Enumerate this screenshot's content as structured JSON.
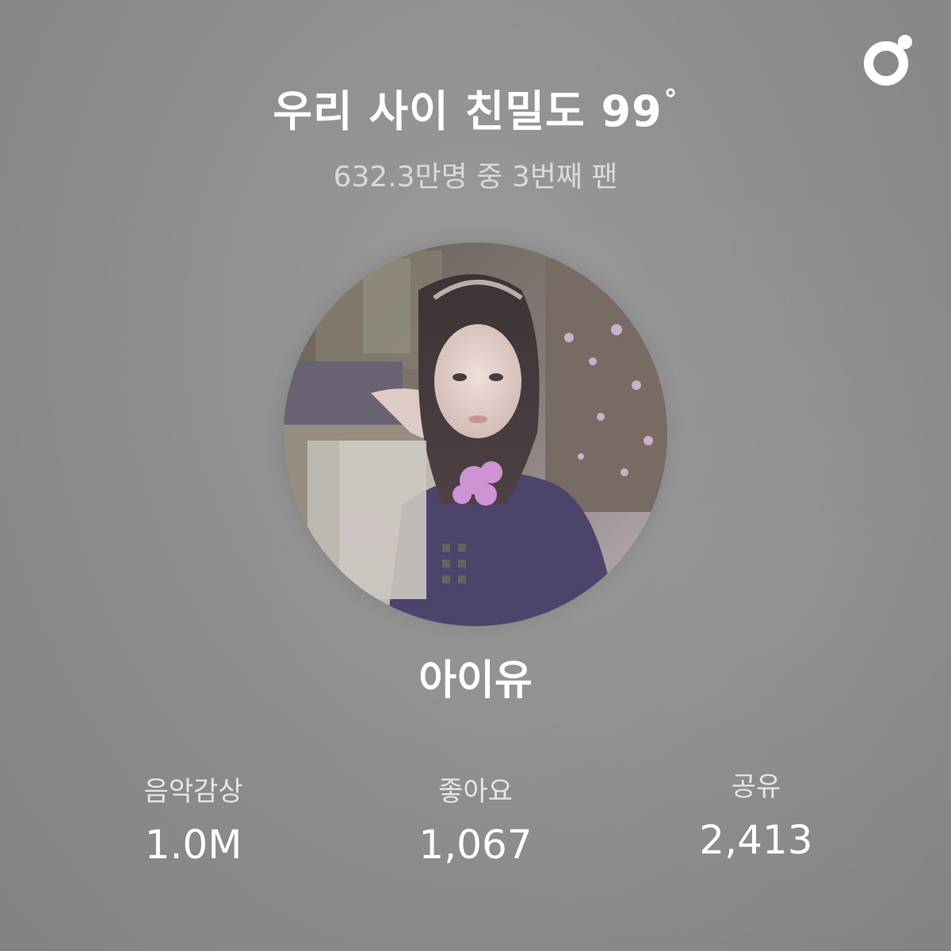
{
  "header": {
    "title": "우리 사이 친밀도 99",
    "degree_symbol": "°",
    "subtitle": "632.3만명 중 3번째 팬"
  },
  "brand": {
    "icon": "melon-logo-icon",
    "color": "#ffffff"
  },
  "artist": {
    "name": "아이유",
    "photo_icon": "artist-photo"
  },
  "stats": [
    {
      "label": "음악감상",
      "value": "1.0M"
    },
    {
      "label": "좋아요",
      "value": "1,067"
    },
    {
      "label": "공유",
      "value": "2,413"
    }
  ],
  "colors": {
    "background": "#8f8f8f",
    "text_primary": "#ffffff",
    "text_secondary": "#dadada"
  }
}
